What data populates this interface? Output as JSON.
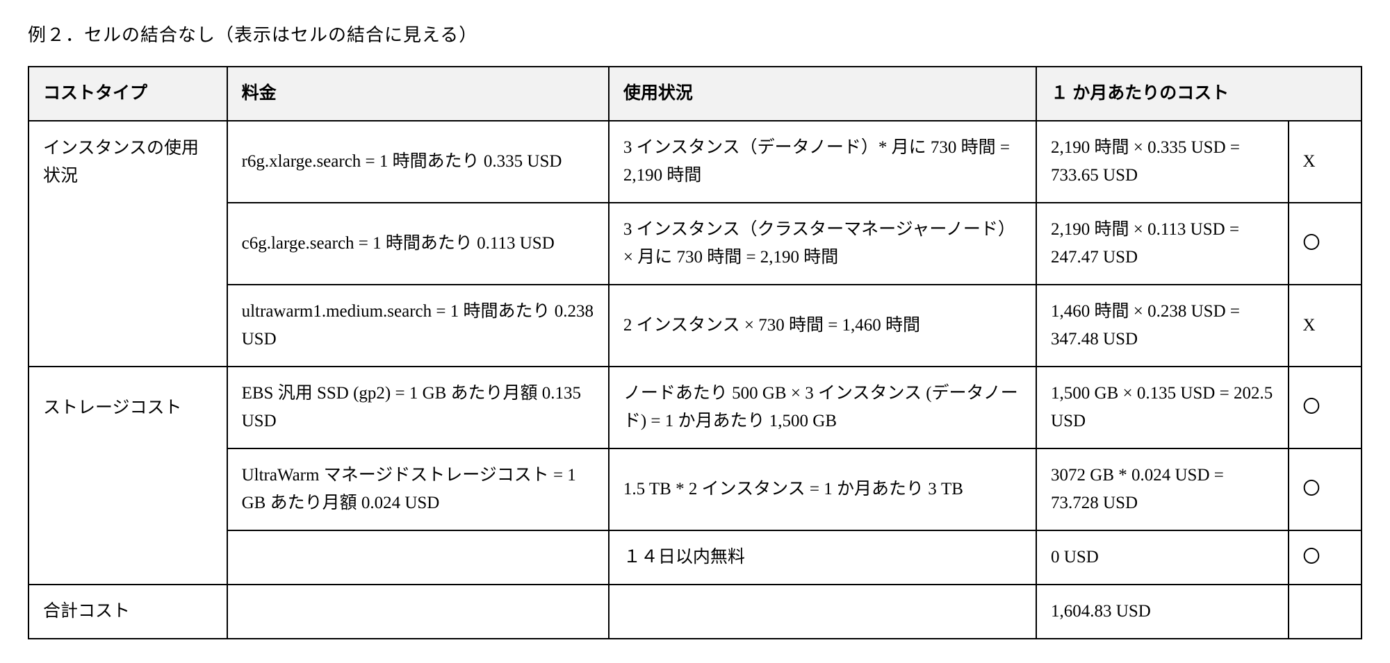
{
  "title": "例２．セルの結合なし（表示はセルの結合に見える）",
  "headers": {
    "c0": "コストタイプ",
    "c1": "料金",
    "c2": "使用状況",
    "c3": "１ か月あたりのコスト",
    "c4": ""
  },
  "rows": [
    {
      "cost_type": "インスタンスの使用状況",
      "rate": "r6g.xlarge.search = 1 時間あたり 0.335 USD",
      "usage": "3 インスタンス（データノード）* 月に 730 時間 = 2,190 時間",
      "monthly": "2,190 時間 × 0.335 USD = 733.65 USD",
      "mark": "X"
    },
    {
      "cost_type": "",
      "rate": "c6g.large.search = 1 時間あたり 0.113 USD",
      "usage": "3 インスタンス（クラスターマネージャーノード）× 月に 730 時間 = 2,190 時間",
      "monthly": "2,190 時間 × 0.113 USD = 247.47 USD",
      "mark": "〇"
    },
    {
      "cost_type": "",
      "rate": "ultrawarm1.medium.search = 1 時間あたり 0.238 USD",
      "usage": "2 インスタンス × 730 時間 = 1,460 時間",
      "monthly": "1,460 時間 × 0.238 USD = 347.48 USD",
      "mark": "X"
    },
    {
      "cost_type": "ストレージコスト",
      "rate": "EBS 汎用 SSD (gp2) = 1 GB あたり月額 0.135 USD",
      "usage": "ノードあたり 500 GB × 3 インスタンス (データノード) = 1 か月あたり 1,500 GB",
      "monthly": "1,500 GB × 0.135 USD = 202.5 USD",
      "mark": "〇"
    },
    {
      "cost_type": "",
      "rate": "UltraWarm マネージドストレージコスト = 1 GB あたり月額 0.024 USD",
      "usage": "1.5 TB * 2 インスタンス = 1 か月あたり 3 TB",
      "monthly": "3072 GB * 0.024 USD = 73.728 USD",
      "mark": "〇"
    },
    {
      "cost_type": "",
      "rate": "",
      "usage": "１４日以内無料",
      "monthly": " 0  USD",
      "mark": "〇"
    },
    {
      "cost_type": "合計コスト",
      "rate": "",
      "usage": "",
      "monthly": "1,604.83 USD",
      "mark": ""
    }
  ],
  "merge_hints": {
    "col0_no_top_rows": [
      1,
      2,
      4,
      5
    ],
    "col0_no_bottom_rows": [
      0,
      1,
      3,
      4
    ]
  }
}
